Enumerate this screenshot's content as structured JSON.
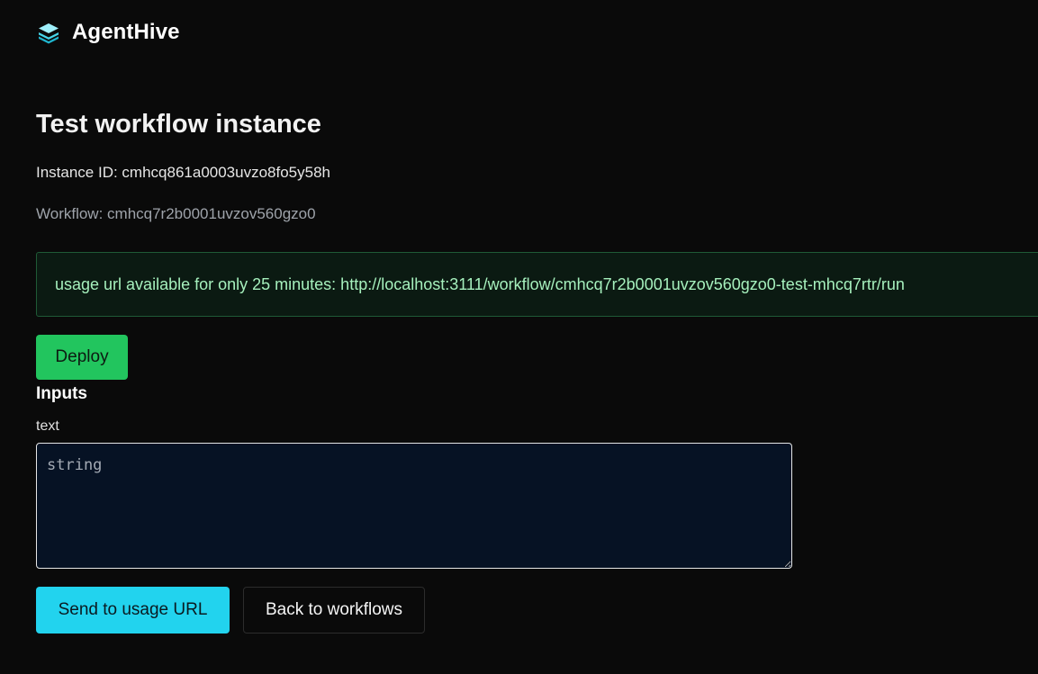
{
  "header": {
    "brand": "AgentHive",
    "logo_icon": "layers-icon",
    "logo_colors": [
      "#1fb6d0",
      "#46d6ea",
      "#9ff0fb"
    ]
  },
  "main": {
    "title": "Test workflow instance",
    "instance_line": "Instance ID: cmhcq861a0003uvzo8fo5y58h",
    "workflow_line": "Workflow: cmhcq7r2b0001uvzov560gzo0",
    "usage_notice": "usage url available for only 25 minutes: http://localhost:3111/workflow/cmhcq7r2b0001uvzov560gzo0-test-mhcq7rtr/run",
    "deploy_label": "Deploy"
  },
  "inputs": {
    "heading": "Inputs",
    "field_label": "text",
    "field_placeholder": "string",
    "field_value": ""
  },
  "actions": {
    "send_label": "Send to usage URL",
    "back_label": "Back to workflows"
  },
  "colors": {
    "background": "#0a0a0a",
    "deploy": "#22c55e",
    "send": "#22d3ee",
    "notice_text": "#a6f0bd",
    "notice_border": "#1f5a36"
  }
}
